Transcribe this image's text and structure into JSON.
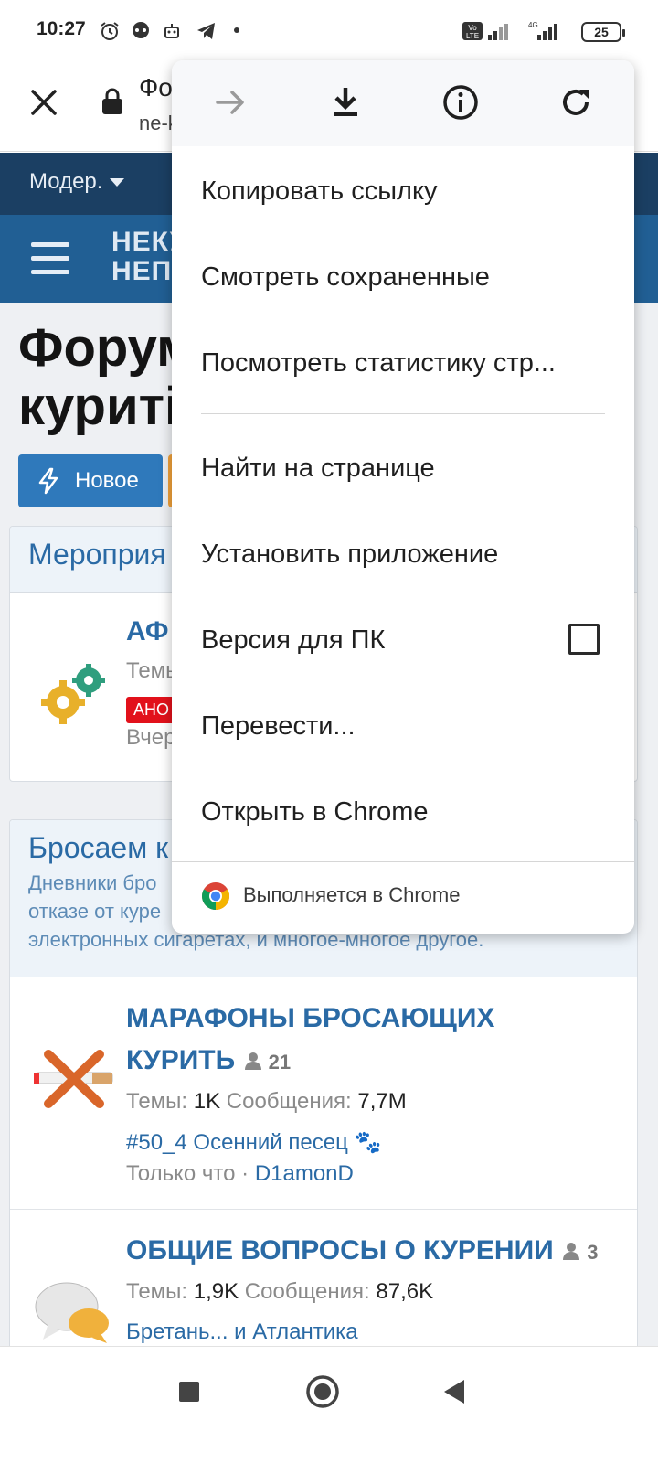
{
  "status_bar": {
    "time": "10:27",
    "battery": "25"
  },
  "tab": {
    "title": "Фо",
    "url": "ne-k"
  },
  "forum": {
    "nav_label": "Модер.",
    "logo_line1": "НЕКУ",
    "logo_line2": "НЕП",
    "page_title_line1": "Форум",
    "page_title_line2": "куриті",
    "new_button": "Новое",
    "events": {
      "title": "Мероприя",
      "node_title": "АФ",
      "node_stats": "Темы",
      "badge": "АНО",
      "last": "Вчер"
    },
    "quit": {
      "title": "Бросаем к",
      "desc_line1": "Дневники бро",
      "desc_line2": "отказе от куре",
      "desc_line3": "электронных сигаретах, и многое-многое другое."
    },
    "nodes": [
      {
        "title_line1": "МАРАФОНЫ БРОСАЮЩИХ",
        "title_line2": "КУРИТЬ",
        "users": "21",
        "threads_label": "Темы:",
        "threads": "1K",
        "messages_label": "Сообщения:",
        "messages": "7,7M",
        "last_post": "#50_4 Осенний песец 🐾",
        "last_time": "Только что ·",
        "last_user": "D1amonD"
      },
      {
        "title_line1": "ОБЩИЕ ВОПРОСЫ О КУРЕНИИ",
        "users": "3",
        "threads_label": "Темы:",
        "threads": "1,9K",
        "messages_label": "Сообщения:",
        "messages": "87,6K",
        "last_post": "Бретань... и Атлантика"
      }
    ]
  },
  "menu": {
    "items": [
      "Копировать ссылку",
      "Смотреть сохраненные",
      "Посмотреть статистику стр...",
      "Найти на странице",
      "Установить приложение",
      "Версия для ПК",
      "Перевести...",
      "Открыть в Chrome"
    ],
    "footer": "Выполняется в Chrome"
  },
  "colors": {
    "accent": "#2a6aa5",
    "nav": "#1b3f63",
    "header": "#215f94"
  }
}
